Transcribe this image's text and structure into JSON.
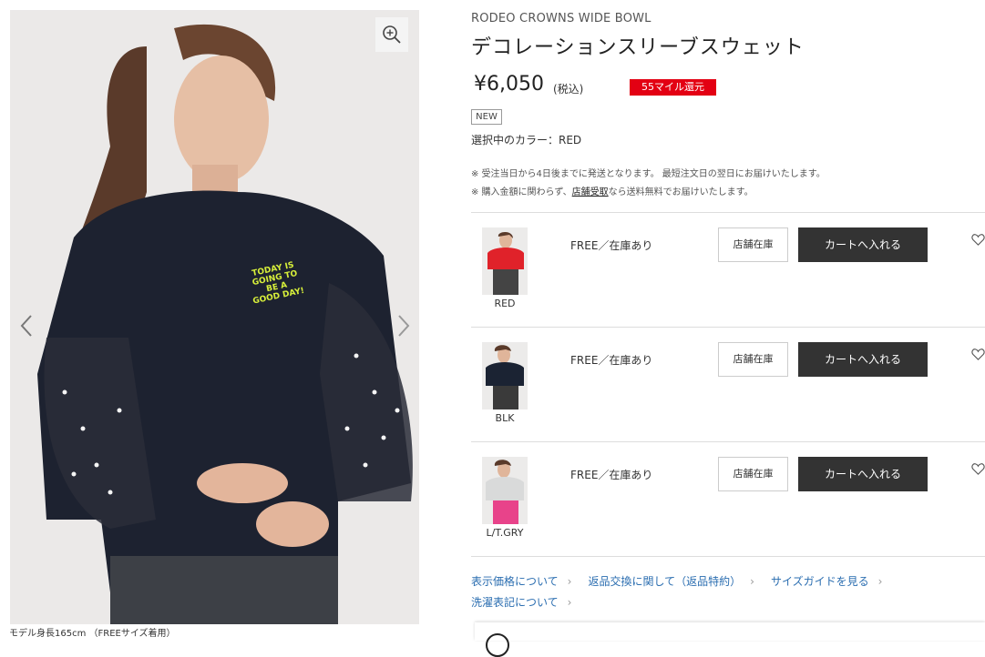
{
  "product": {
    "brand": "RODEO CROWNS WIDE BOWL",
    "title": "デコレーションスリーブスウェット",
    "price": "¥6,050",
    "price_tax": "(税込)",
    "mile_badge": "55マイル還元",
    "new_badge": "NEW",
    "selected_color": "選択中のカラー：RED"
  },
  "gallery": {
    "caption": "モデル身長165cm （FREEサイズ着用）",
    "print_text": [
      "TODAY IS",
      "GOING TO",
      "BE A",
      "GOOD DAY!"
    ]
  },
  "notes": {
    "line1": "※ 受注当日から4日後までに発送となります。 最短注文日の翌日にお届けいたします。",
    "line2_prefix": "※ 購入金額に関わらず、",
    "line2_link": "店舗受取",
    "line2_suffix": "なら送料無料でお届けいたします。"
  },
  "variants": [
    {
      "color": "RED",
      "stock": "FREE／在庫あり",
      "store_label": "店舗在庫",
      "cart_label": "カートへ入れる",
      "swatch": "#e0222a",
      "pants": "#444"
    },
    {
      "color": "BLK",
      "stock": "FREE／在庫あり",
      "store_label": "店舗在庫",
      "cart_label": "カートへ入れる",
      "swatch": "#1b2333",
      "pants": "#3a3a3a"
    },
    {
      "color": "L/T.GRY",
      "stock": "FREE／在庫あり",
      "store_label": "店舗在庫",
      "cart_label": "カートへ入れる",
      "swatch": "#d9dada",
      "pants": "#e8438a"
    }
  ],
  "links": {
    "price_info": "表示価格について",
    "returns": "返品交換に関して（返品特約）",
    "size_guide": "サイズガイドを見る",
    "care_label": "洗濯表記について"
  },
  "icons": {
    "zoom": "zoom-in-icon",
    "prev": "chevron-left-icon",
    "next": "chevron-right-icon",
    "heart": "heart-outline-icon",
    "chevron": "chevron-right-icon"
  },
  "colors": {
    "mile_badge": "#e30013",
    "cart_button": "#333333",
    "link": "#2a6db0"
  }
}
